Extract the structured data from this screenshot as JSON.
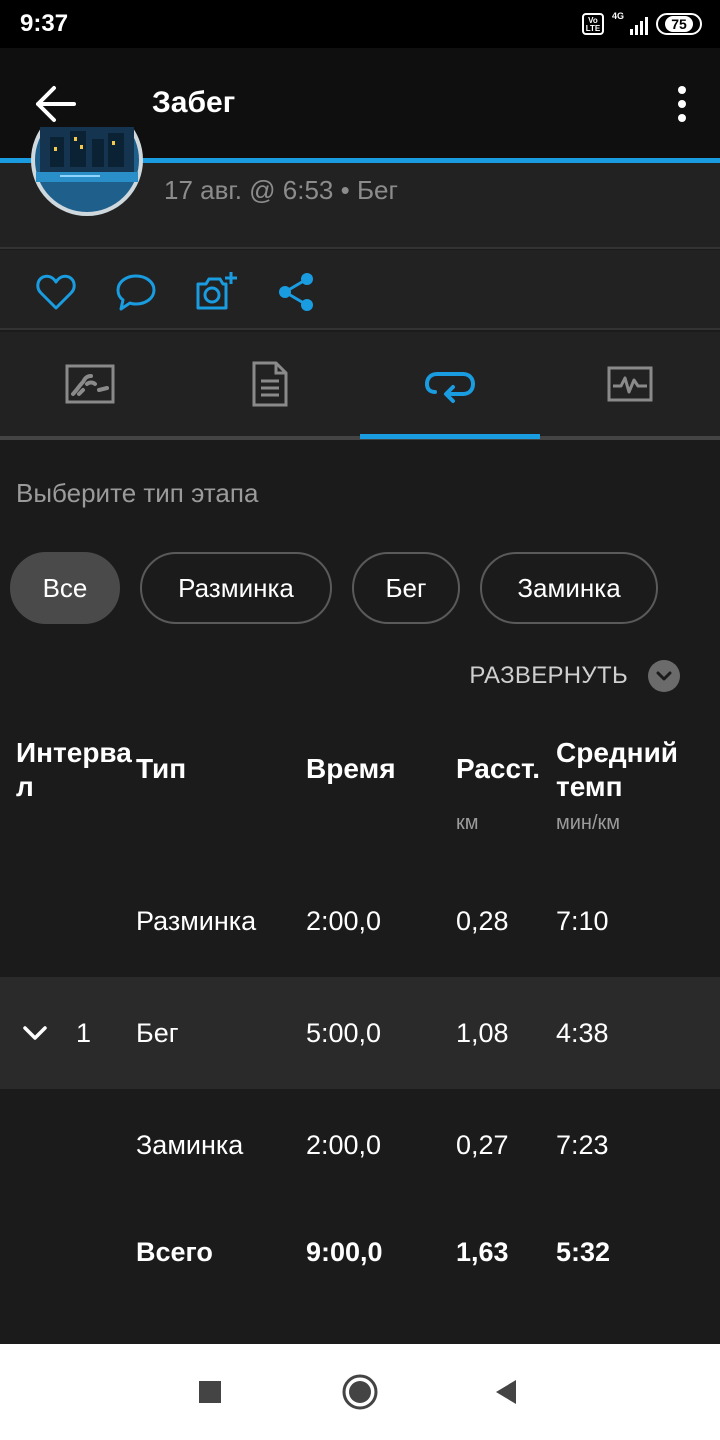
{
  "status_bar": {
    "time": "9:37",
    "volte": "Vo LTE",
    "network": "4G",
    "battery": "75"
  },
  "app_bar": {
    "title": "Забег"
  },
  "activity": {
    "meta": "17 авг. @ 6:53 • Бег"
  },
  "tabs": [
    {
      "icon": "map-icon",
      "active": false
    },
    {
      "icon": "document-icon",
      "active": false
    },
    {
      "icon": "laps-icon",
      "active": true
    },
    {
      "icon": "chart-icon",
      "active": false
    }
  ],
  "filter": {
    "title": "Выберите тип этапа",
    "chips": [
      {
        "label": "Все",
        "active": true
      },
      {
        "label": "Разминка",
        "active": false
      },
      {
        "label": "Бег",
        "active": false
      },
      {
        "label": "Заминка",
        "active": false
      }
    ],
    "expand_label": "РАЗВЕРНУТЬ"
  },
  "table": {
    "headers": {
      "interval": "Интерва\nл",
      "type": "Тип",
      "time": "Время",
      "distance": "Расст.",
      "distance_unit": "км",
      "pace": "Средний\nтемп",
      "pace_unit": "мин/км"
    },
    "rows": [
      {
        "interval": "",
        "type": "Разминка",
        "time": "2:00,0",
        "distance": "0,28",
        "pace": "7:10"
      },
      {
        "interval": "1",
        "type": "Бег",
        "time": "5:00,0",
        "distance": "1,08",
        "pace": "4:38"
      },
      {
        "interval": "",
        "type": "Заминка",
        "time": "2:00,0",
        "distance": "0,27",
        "pace": "7:23"
      }
    ],
    "total": {
      "type": "Всего",
      "time": "9:00,0",
      "distance": "1,63",
      "pace": "5:32"
    }
  },
  "colors": {
    "accent": "#1a9ce0",
    "background": "#1b1b1b",
    "card": "#222222",
    "muted": "#8c8c8c"
  }
}
